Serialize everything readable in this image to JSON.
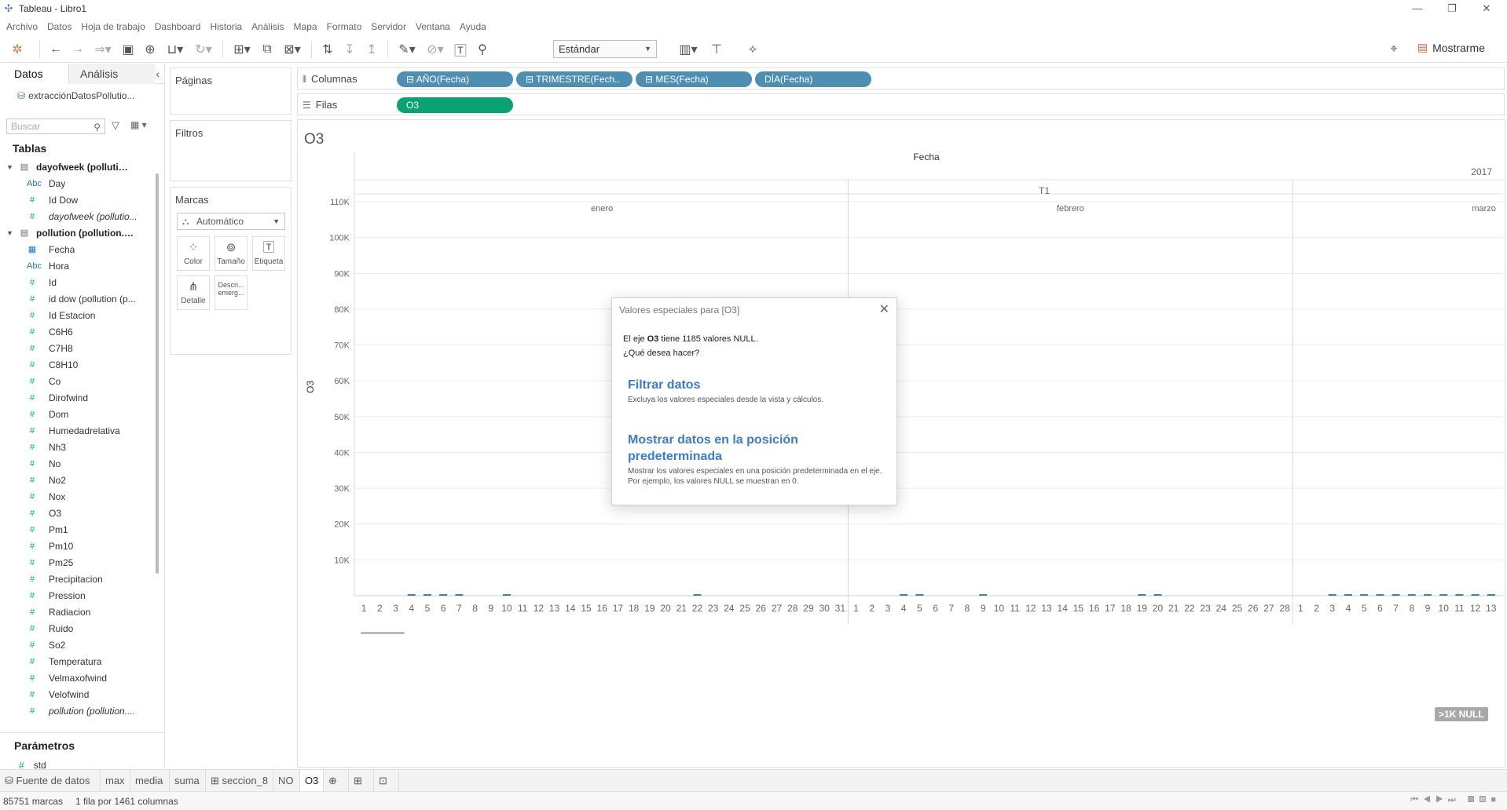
{
  "window": {
    "title": "Tableau - Libro1",
    "min": "—",
    "max": "❐",
    "close": "✕"
  },
  "menu": [
    "Archivo",
    "Datos",
    "Hoja de trabajo",
    "Dashboard",
    "Historia",
    "Análisis",
    "Mapa",
    "Formato",
    "Servidor",
    "Ventana",
    "Ayuda"
  ],
  "toolbar": {
    "fit": "Estándar",
    "show_me": "Mostrarme"
  },
  "data_pane": {
    "tab_data": "Datos",
    "tab_analysis": "Análisis",
    "datasource": "extracciónDatosPollutio...",
    "search_placeholder": "Buscar",
    "tables_heading": "Tablas",
    "params_heading": "Parámetros",
    "param_std": "std",
    "fields": [
      {
        "g": true,
        "label": "dayofweek (pollution...."
      },
      {
        "t": "dim-abc",
        "label": "Day"
      },
      {
        "t": "meas",
        "label": "Id Dow"
      },
      {
        "t": "meas",
        "label": "dayofweek (pollutio...",
        "italic": true
      },
      {
        "g": true,
        "label": "pollution (pollution.po..."
      },
      {
        "t": "date",
        "label": "Fecha"
      },
      {
        "t": "dim-abc",
        "label": "Hora"
      },
      {
        "t": "meas",
        "label": "Id"
      },
      {
        "t": "meas",
        "label": "id dow (pollution (p..."
      },
      {
        "t": "meas",
        "label": "Id Estacion"
      },
      {
        "t": "meas",
        "label": "C6H6"
      },
      {
        "t": "meas",
        "label": "C7H8"
      },
      {
        "t": "meas",
        "label": "C8H10"
      },
      {
        "t": "meas",
        "label": "Co"
      },
      {
        "t": "meas",
        "label": "Dirofwind"
      },
      {
        "t": "meas",
        "label": "Dom"
      },
      {
        "t": "meas",
        "label": "Humedadrelativa"
      },
      {
        "t": "meas",
        "label": "Nh3"
      },
      {
        "t": "meas",
        "label": "No"
      },
      {
        "t": "meas",
        "label": "No2"
      },
      {
        "t": "meas",
        "label": "Nox"
      },
      {
        "t": "meas",
        "label": "O3"
      },
      {
        "t": "meas",
        "label": "Pm1"
      },
      {
        "t": "meas",
        "label": "Pm10"
      },
      {
        "t": "meas",
        "label": "Pm25"
      },
      {
        "t": "meas",
        "label": "Precipitacion"
      },
      {
        "t": "meas",
        "label": "Pression"
      },
      {
        "t": "meas",
        "label": "Radiacion"
      },
      {
        "t": "meas",
        "label": "Ruido"
      },
      {
        "t": "meas",
        "label": "So2"
      },
      {
        "t": "meas",
        "label": "Temperatura"
      },
      {
        "t": "meas",
        "label": "Velmaxofwind"
      },
      {
        "t": "meas",
        "label": "Velofwind"
      },
      {
        "t": "meas",
        "label": "pollution (pollution....",
        "italic": true
      }
    ]
  },
  "cards": {
    "pages": "Páginas",
    "filters": "Filtros",
    "marks": "Marcas",
    "mark_type": "Automático",
    "buttons": [
      "Color",
      "Tamaño",
      "Etiqueta",
      "Detalle",
      "Descri... emerg..."
    ]
  },
  "shelves": {
    "columns_label": "Columnas",
    "rows_label": "Filas",
    "column_pills": [
      "⊟ AÑO(Fecha)",
      "⊟ TRIMESTRE(Fech..",
      "⊟ MES(Fecha)",
      "DÍA(Fecha)"
    ],
    "row_pills": [
      "O3"
    ]
  },
  "view": {
    "title": "O3",
    "null_badge": ">1K NULL"
  },
  "chart_data": {
    "type": "bar",
    "title": "O3",
    "xlabel": "Fecha",
    "ylabel": "O3",
    "year": "2017",
    "quarter": "T1",
    "months": [
      {
        "name": "enero",
        "days": 31
      },
      {
        "name": "febrero",
        "days": 28
      },
      {
        "name": "marzo",
        "days_visible": 13
      }
    ],
    "ylim": [
      0,
      115000
    ],
    "yticks": [
      "10K",
      "20K",
      "30K",
      "40K",
      "50K",
      "60K",
      "70K",
      "80K",
      "90K",
      "100K",
      "110K"
    ],
    "note": "Valores casi nulos visibles en el eje cero"
  },
  "dialog": {
    "title": "Valores especiales para [O3]",
    "msg1_prefix": "El eje ",
    "msg1_bold": "O3",
    "msg1_suffix": " tiene 1185 valores NULL.",
    "msg2": "¿Qué desea hacer?",
    "opt1_title": "Filtrar datos",
    "opt1_desc": "Excluya los valores especiales desde la vista y cálculos.",
    "opt2_title": "Mostrar datos en la posición predeterminada",
    "opt2_desc": "Mostrar los valores especiales en una posición predeterminada en el eje. Por ejemplo, los valores NULL se muestran en 0."
  },
  "sheet_tabs": [
    "Fuente de datos",
    "max",
    "media",
    "suma",
    "seccion_8",
    "NO",
    "O3"
  ],
  "status": {
    "marks": "85751 marcas",
    "dims": "1 fila por 1461 columnas"
  }
}
